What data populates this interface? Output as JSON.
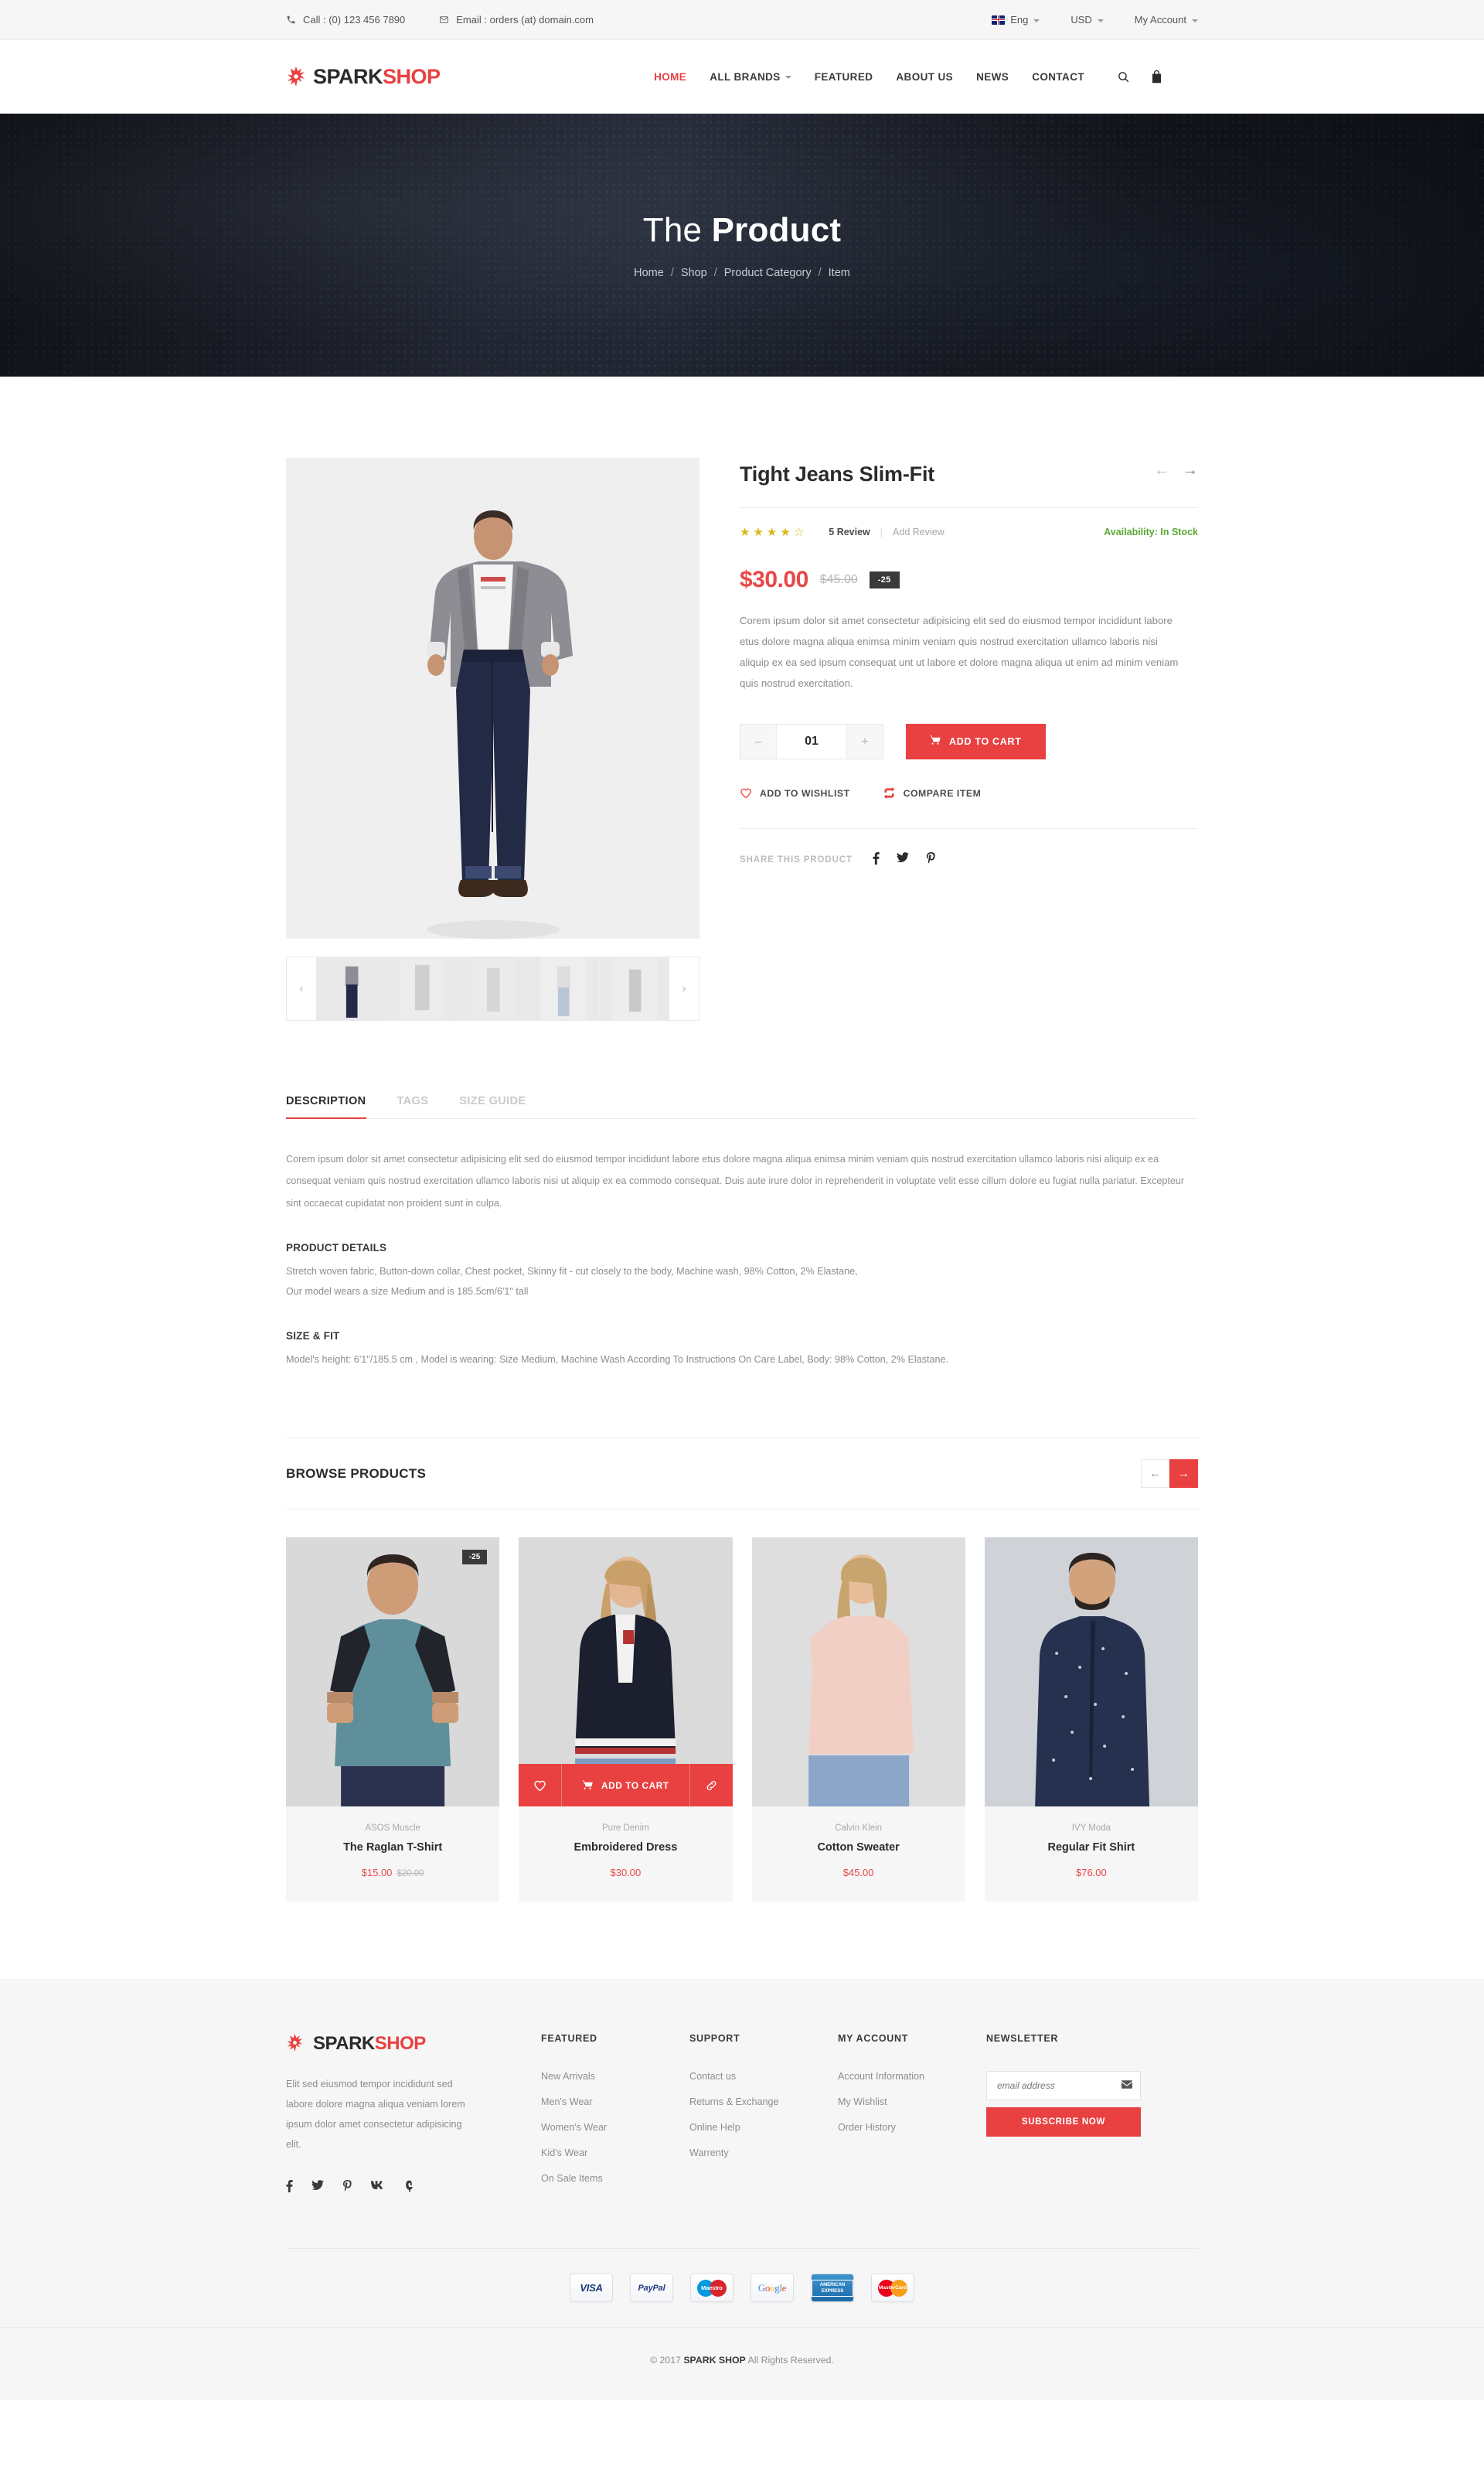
{
  "topbar": {
    "phone_label": "Call : (0) 123 456 7890",
    "phone_icon": "phone-icon",
    "email_label": "Email : orders (at) domain.com",
    "email_icon": "envelope-icon",
    "language": "Eng",
    "currency": "USD",
    "account": "My Account"
  },
  "brand": {
    "part1": "SPARK",
    "part2": "SHOP"
  },
  "nav": {
    "items": [
      {
        "label": "HOME",
        "active": true,
        "dropdown": false
      },
      {
        "label": "ALL BRANDS",
        "active": false,
        "dropdown": true
      },
      {
        "label": "FEATURED",
        "active": false,
        "dropdown": false
      },
      {
        "label": "ABOUT US",
        "active": false,
        "dropdown": false
      },
      {
        "label": "NEWS",
        "active": false,
        "dropdown": false
      },
      {
        "label": "CONTACT",
        "active": false,
        "dropdown": false
      }
    ],
    "tools": [
      "search-icon",
      "bag-icon",
      "menu-icon"
    ]
  },
  "hero": {
    "title_light": "The",
    "title_bold": "Product",
    "breadcrumb": [
      "Home",
      "Shop",
      "Product Category",
      "Item"
    ]
  },
  "product": {
    "title": "Tight Jeans Slim-Fit",
    "prev_icon": "arrow-left-icon",
    "next_icon": "arrow-right-icon",
    "rating": 4,
    "rating_max": 5,
    "reviews_label": "5 Review",
    "add_review_label": "Add Review",
    "availability": "Availability: In Stock",
    "price": "$30.00",
    "price_old": "$45.00",
    "discount_badge": "-25",
    "description": "Corem ipsum dolor sit amet consectetur adipisicing elit sed do eiusmod tempor incididunt labore etus dolore magna aliqua enimsa minim veniam quis nostrud exercitation ullamco laboris nisi aliquip ex ea sed ipsum consequat unt ut labore et dolore magna aliqua ut enim ad minim veniam quis nostrud exercitation.",
    "qty_value": "01",
    "qty_minus": "–",
    "qty_plus": "+",
    "add_to_cart": "ADD TO CART",
    "wishlist": "ADD TO WISHLIST",
    "compare": "COMPARE ITEM",
    "share_label": "SHARE THIS PRODUCT",
    "share_icons": [
      "facebook-icon",
      "twitter-icon",
      "pinterest-icon"
    ],
    "thumb_prev": "‹",
    "thumb_next": "›"
  },
  "tabs": {
    "items": [
      {
        "label": "DESCRIPTION",
        "active": true
      },
      {
        "label": "TAGS",
        "active": false
      },
      {
        "label": "SIZE GUIDE",
        "active": false
      }
    ],
    "description": "Corem ipsum dolor sit amet consectetur adipisicing elit sed do eiusmod tempor incididunt labore etus dolore magna aliqua enimsa minim veniam quis nostrud exercitation ullamco laboris nisi aliquip ex ea consequat veniam quis nostrud exercitation ullamco laboris nisi ut aliquip ex ea commodo consequat. Duis aute irure dolor in reprehenderit in voluptate velit esse cillum dolore eu fugiat nulla pariatur. Excepteur sint occaecat cupidatat non proident sunt in culpa.",
    "details_heading": "PRODUCT DETAILS",
    "details_line1": "Stretch woven fabric, Button-down collar, Chest pocket, Skinny fit - cut closely to the body, Machine wash, 98% Cotton, 2% Elastane,",
    "details_line2": "Our model wears a size Medium and is 185.5cm/6'1\" tall",
    "sizefit_heading": "SIZE & FIT",
    "sizefit_line": "Model's height: 6'1\"/185.5 cm , Model is wearing: Size Medium, Machine Wash According To Instructions On Care Label, Body: 98% Cotton, 2% Elastane."
  },
  "browse": {
    "heading": "BROWSE PRODUCTS",
    "prev_icon": "arrow-left-icon",
    "next_icon": "arrow-right-icon",
    "overlay": {
      "wishlist_icon": "heart-icon",
      "cart_icon": "cart-icon",
      "add_to_cart": "ADD TO CART",
      "link_icon": "link-icon"
    },
    "products": [
      {
        "brand": "ASOS Muscle",
        "name": "The Raglan T-Shirt",
        "price": "$15.00",
        "price_old": "$20.00",
        "badge": "-25",
        "hover": false
      },
      {
        "brand": "Pure Denim",
        "name": "Embroidered Dress",
        "price": "$30.00",
        "price_old": "",
        "badge": "",
        "hover": true
      },
      {
        "brand": "Calvin Klein",
        "name": "Cotton Sweater",
        "price": "$45.00",
        "price_old": "",
        "badge": "",
        "hover": false
      },
      {
        "brand": "IVY Moda",
        "name": "Regular Fit Shirt",
        "price": "$76.00",
        "price_old": "",
        "badge": "",
        "hover": false
      }
    ]
  },
  "footer": {
    "about_text": "Elit sed eiusmod tempor incididunt sed labore dolore magna aliqua veniam lorem ipsum dolor amet consectetur adipisicing elit.",
    "social": [
      "facebook-icon",
      "twitter-icon",
      "pinterest-icon",
      "vk-icon",
      "vine-icon"
    ],
    "columns": [
      {
        "heading": "FEATURED",
        "links": [
          "New Arrivals",
          "Men's Wear",
          "Women's Wear",
          "Kid's Wear",
          "On Sale Items"
        ]
      },
      {
        "heading": "SUPPORT",
        "links": [
          "Contact us",
          "Returns & Exchange",
          "Online Help",
          "Warrenty"
        ]
      },
      {
        "heading": "MY ACCOUNT",
        "links": [
          "Account Information",
          "My Wishlist",
          "Order History"
        ]
      }
    ],
    "newsletter": {
      "heading": "NEWSLETTER",
      "placeholder": "email address",
      "value": "",
      "envelope_icon": "envelope-icon",
      "button": "SUBSCRIBE NOW"
    },
    "payments": [
      "VISA",
      "PayPal",
      "Maestro",
      "Google",
      "AMERICAN EXPRESS",
      "MasterCard"
    ],
    "copyright_pre": "© 2017",
    "copyright_brand": "SPARK SHOP",
    "copyright_post": "All Rights Reserved."
  },
  "colors": {
    "accent": "#e94141",
    "dark": "#2b2b2b",
    "muted": "#8d8d8d",
    "stock_green": "#5aa832",
    "star_gold": "#d8b915"
  }
}
